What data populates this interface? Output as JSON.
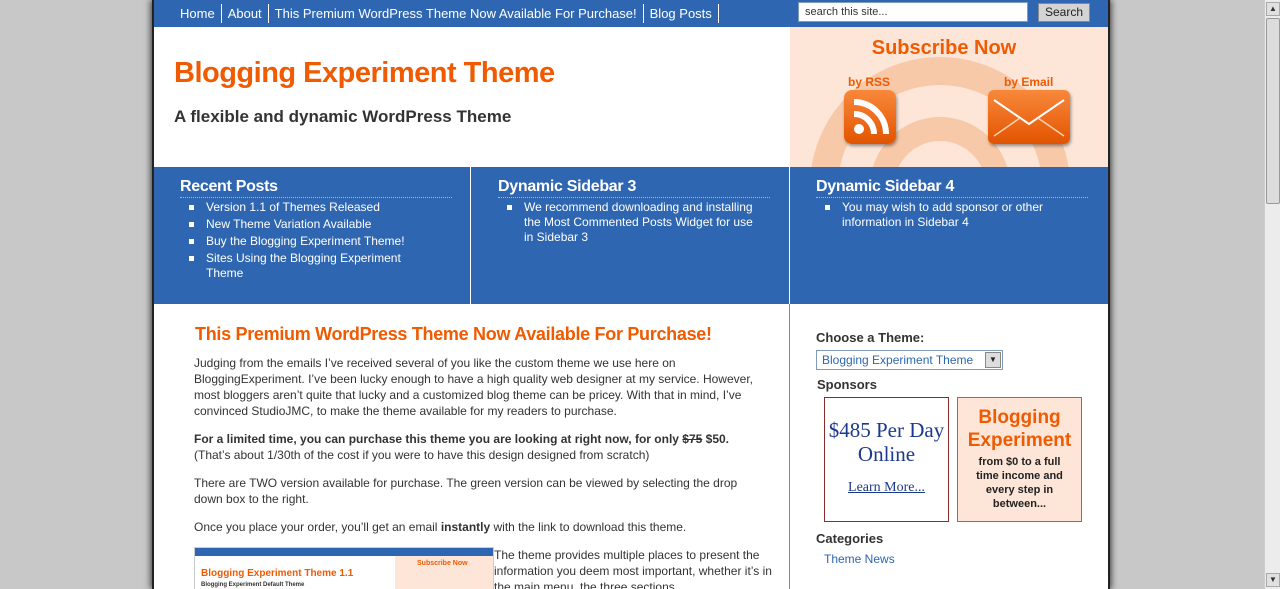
{
  "nav": {
    "items": [
      "Home",
      "About",
      "This Premium WordPress Theme Now Available For Purchase!",
      "Blog Posts"
    ],
    "search_placeholder": "search this site...",
    "search_button": "Search"
  },
  "header": {
    "title": "Blogging Experiment Theme",
    "tagline": "A flexible and dynamic WordPress Theme"
  },
  "subscribe": {
    "title": "Subscribe Now",
    "rss_label": "by RSS",
    "email_label": "by Email",
    "rss_icon": "rss-feed-icon",
    "email_icon": "envelope-icon"
  },
  "widgets": [
    {
      "title": "Recent Posts",
      "items": [
        "Version 1.1 of Themes Released",
        "New Theme Variation Available",
        "Buy the Blogging Experiment Theme!",
        "Sites Using the Blogging Experiment Theme"
      ]
    },
    {
      "title": "Dynamic Sidebar 3",
      "items": [
        "We recommend downloading and installing the Most Commented Posts Widget for use in Sidebar 3"
      ]
    },
    {
      "title": "Dynamic Sidebar 4",
      "items": [
        "You may wish to add sponsor or other information in Sidebar 4"
      ]
    }
  ],
  "post": {
    "title": "This Premium WordPress Theme Now Available For Purchase!",
    "p1": "Judging from the emails I’ve received several of you like the custom theme we use here on BloggingExperiment. I’ve been lucky enough to have a high quality web designer at my service. However, most bloggers aren’t quite that lucky and a customized blog theme can be pricey. With that in mind, I’ve convinced StudioJMC, to make the theme available for my readers to purchase.",
    "p2_bold_a": "For a limited time, you can purchase this theme you are looking at right now, for only ",
    "p2_old_price": "$75",
    "p2_new_price": " $50.",
    "p2_note": "(That’s about 1/30th of the cost if you were to have this design designed from scratch)",
    "p3": "There are TWO version available for purchase. The green version can be viewed by selecting the drop down box to the right.",
    "p4_a": "Once you place your order, you’ll get an email ",
    "p4_bold": "instantly",
    "p4_b": " with the link to download this theme.",
    "p5": "The theme provides multiple places to present the information you deem most important, whether it’s in the main menu, the three sections",
    "thumb_title": "Blogging Experiment Theme 1.1",
    "thumb_sub": "Blogging Experiment Default Theme",
    "thumb_subscribe": "Subscribe Now"
  },
  "sidebar": {
    "choose_heading": "Choose a Theme:",
    "theme_selected": "Blogging Experiment Theme",
    "sponsors_heading": "Sponsors",
    "ad1_text": "$485 Per Day Online",
    "ad1_link": "Learn More...",
    "ad2_title": "Blogging Experiment",
    "ad2_sub": "from $0 to a full time income and every step in between...",
    "categories_heading": "Categories",
    "category_link": "Theme News"
  },
  "colors": {
    "accent_orange": "#f05a00",
    "nav_blue": "#2f66b1",
    "subscribe_bg": "#fde6d8"
  }
}
